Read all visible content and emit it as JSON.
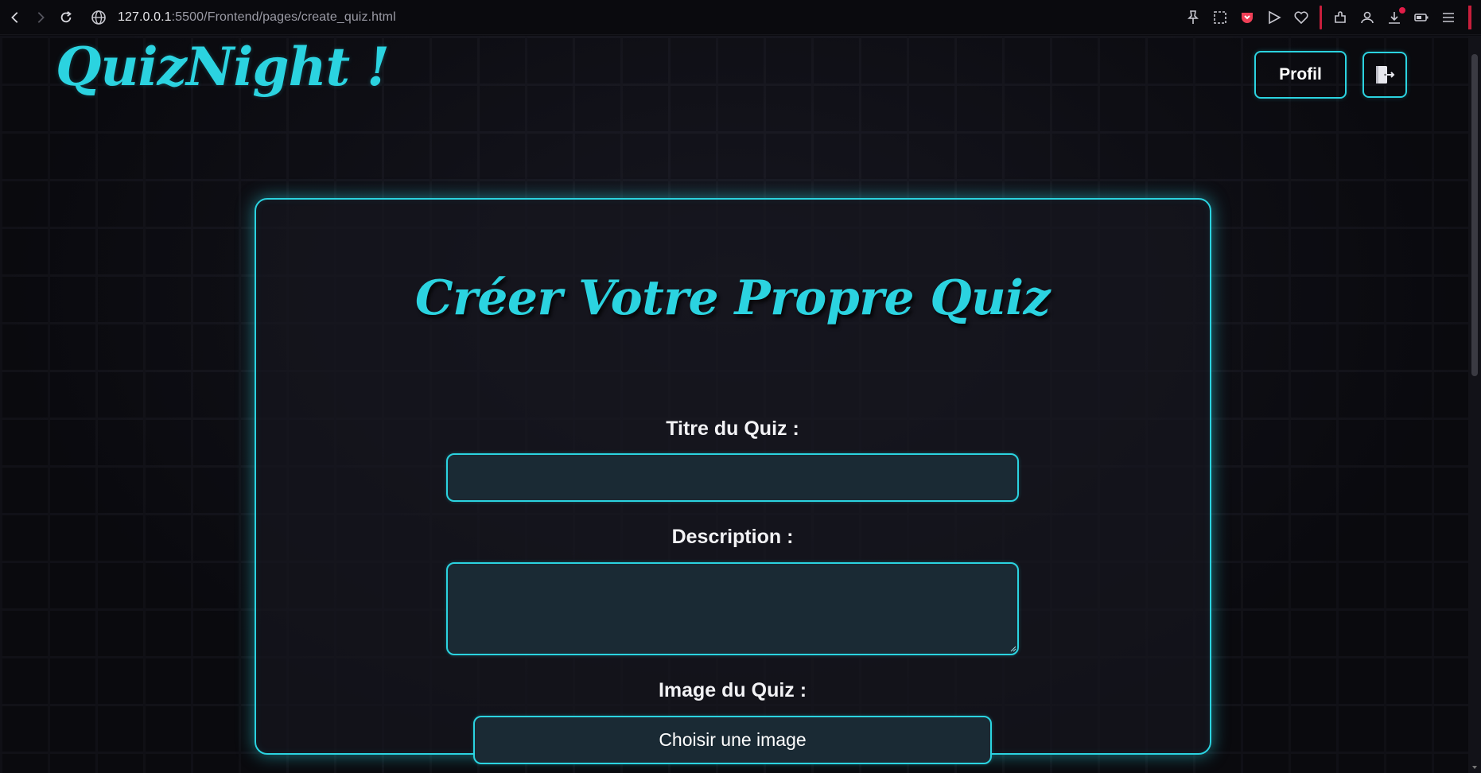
{
  "browser": {
    "url_host": "127.0.0.1",
    "url_path": ":5500/Frontend/pages/create_quiz.html"
  },
  "header": {
    "logo": "QuizNight !",
    "profile_button": "Profil"
  },
  "form": {
    "title": "Créer Votre Propre Quiz",
    "quiz_title_label": "Titre du Quiz :",
    "quiz_title_value": "",
    "description_label": "Description :",
    "description_value": "",
    "image_label": "Image du Quiz :",
    "choose_image_button": "Choisir une image"
  },
  "colors": {
    "accent": "#2bd3e0",
    "background": "#0d0d13",
    "input_fill": "#1a2a34"
  }
}
